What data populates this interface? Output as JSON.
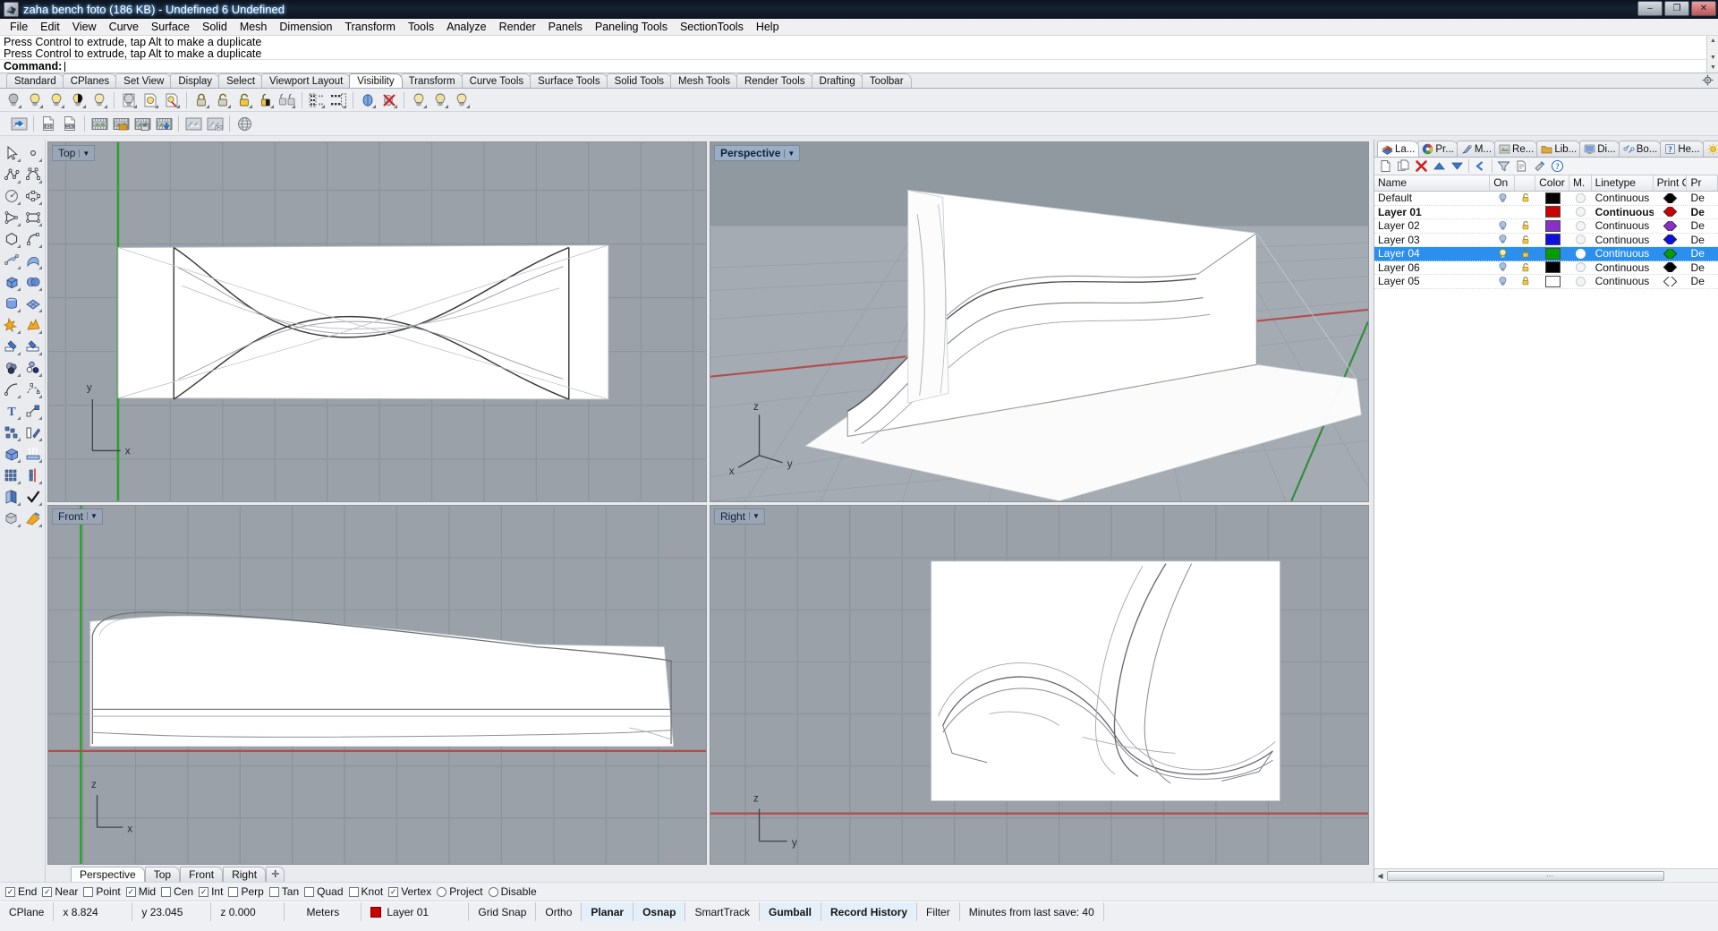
{
  "window": {
    "title": "zaha bench foto (186 KB) - Undefined 6 Undefined",
    "app_icon": "rhino-logo-icon",
    "minimize": "–",
    "maximize": "❐",
    "close": "✕"
  },
  "menu": {
    "items": [
      "File",
      "Edit",
      "View",
      "Curve",
      "Surface",
      "Solid",
      "Mesh",
      "Dimension",
      "Transform",
      "Tools",
      "Analyze",
      "Render",
      "Panels",
      "Paneling Tools",
      "SectionTools",
      "Help"
    ]
  },
  "command": {
    "history": [
      "Press Control to extrude, tap Alt to make a duplicate",
      "Press Control to extrude, tap Alt to make a duplicate"
    ],
    "prompt_label": "Command:",
    "prompt_value": ""
  },
  "toolbar_tabs": {
    "active": "Visibility",
    "items": [
      "Standard",
      "CPlanes",
      "Set View",
      "Display",
      "Select",
      "Viewport Layout",
      "Visibility",
      "Transform",
      "Curve Tools",
      "Surface Tools",
      "Solid Tools",
      "Mesh Tools",
      "Render Tools",
      "Drafting",
      "Toolbar"
    ]
  },
  "visibility_toolbar": {
    "buttons": [
      {
        "name": "hide-objects-icon",
        "title": "Hide objects"
      },
      {
        "name": "show-objects-icon",
        "title": "Show objects"
      },
      {
        "name": "show-selected-icon",
        "title": "Show selected"
      },
      {
        "name": "invert-hidden-icon",
        "title": "Invert hidden"
      },
      {
        "name": "hide-swap-icon",
        "title": "Hide swap"
      },
      {
        "name": "isolate-objects-icon",
        "title": "Isolate objects"
      },
      {
        "name": "unisolate-objects-icon",
        "title": "Un-isolate"
      },
      {
        "name": "isolate-layer-icon",
        "title": "Isolate layer"
      },
      {
        "name": "lock-objects-icon",
        "title": "Lock objects"
      },
      {
        "name": "unlock-objects-icon",
        "title": "Unlock objects"
      },
      {
        "name": "unlock-selected-icon",
        "title": "Unlock selected"
      },
      {
        "name": "invert-locked-icon",
        "title": "Invert locked"
      },
      {
        "name": "lock-swap-icon",
        "title": "Lock swap"
      },
      {
        "name": "select-visible-icon",
        "title": "Select visible"
      },
      {
        "name": "select-hidden-icon",
        "title": "Select hidden"
      },
      {
        "name": "show-in-viewport-icon",
        "title": "Show in viewport"
      },
      {
        "name": "hide-in-viewport-icon",
        "title": "Hide in viewport"
      },
      {
        "name": "show-bulb-1-icon",
        "title": "Show layer 1"
      },
      {
        "name": "show-bulb-2-icon",
        "title": "Show layer 2"
      },
      {
        "name": "show-bulb-3-icon",
        "title": "Show layer 3"
      }
    ]
  },
  "render_toolbar": {
    "buttons": [
      {
        "name": "render-preview-icon",
        "title": "Render preview"
      },
      {
        "name": "export-exe-icon",
        "title": "Export EXE"
      },
      {
        "name": "export-web-icon",
        "title": "Export WEB"
      },
      {
        "name": "animation-icon",
        "title": "Animation"
      },
      {
        "name": "animation-folder-icon",
        "title": "Animation folder"
      },
      {
        "name": "animation-save-icon",
        "title": "Save animation"
      },
      {
        "name": "animation-download-icon",
        "title": "Record animation"
      },
      {
        "name": "render-window-icon",
        "title": "Render window"
      },
      {
        "name": "render-window-jpg-icon",
        "title": "Render to file"
      },
      {
        "name": "globe-render-icon",
        "title": "Environment"
      }
    ]
  },
  "sidebar_tools": {
    "buttons": [
      {
        "name": "select-arrow-icon"
      },
      {
        "name": "point-object-icon"
      },
      {
        "name": "polyline-icon"
      },
      {
        "name": "control-point-curve-icon"
      },
      {
        "name": "circle-icon"
      },
      {
        "name": "ellipse-icon"
      },
      {
        "name": "polygon-triangle-icon"
      },
      {
        "name": "rectangle-icon"
      },
      {
        "name": "polygon-icon"
      },
      {
        "name": "arc-icon"
      },
      {
        "name": "surface-control-points-icon"
      },
      {
        "name": "surface-sweep-icon"
      },
      {
        "name": "box-solid-icon"
      },
      {
        "name": "sphere-solid-icon"
      },
      {
        "name": "cylinder-solid-icon"
      },
      {
        "name": "mesh-plane-icon"
      },
      {
        "name": "boolean-union-icon"
      },
      {
        "name": "boolean-split-icon"
      },
      {
        "name": "trim-icon"
      },
      {
        "name": "split-icon"
      },
      {
        "name": "boolean-objects-icon"
      },
      {
        "name": "point-groups-icon"
      },
      {
        "name": "fillet-curve-icon"
      },
      {
        "name": "offset-curve-icon"
      },
      {
        "name": "text-icon"
      },
      {
        "name": "scale-icon"
      },
      {
        "name": "explode-icon"
      },
      {
        "name": "extrude-icon"
      },
      {
        "name": "box-edit-icon"
      },
      {
        "name": "extrude-surface-icon"
      },
      {
        "name": "array-icon"
      },
      {
        "name": "array-polar-icon"
      },
      {
        "name": "copy-icon"
      },
      {
        "name": "check-objects-icon"
      },
      {
        "name": "cap-planar-holes-icon"
      },
      {
        "name": "render-shade-icon"
      }
    ]
  },
  "viewports": [
    {
      "name": "Top",
      "label": "Top",
      "active": false
    },
    {
      "name": "Perspective",
      "label": "Perspective",
      "active": true
    },
    {
      "name": "Front",
      "label": "Front",
      "active": false
    },
    {
      "name": "Right",
      "label": "Right",
      "active": false
    }
  ],
  "viewport_tabs": {
    "active": "Perspective",
    "items": [
      "Perspective",
      "Top",
      "Front",
      "Right"
    ],
    "add_label": "✛"
  },
  "panel_tabs": {
    "active": "La...",
    "items": [
      {
        "label": "La...",
        "icon": "layers-icon",
        "full": "Layers"
      },
      {
        "label": "Pr...",
        "icon": "properties-icon",
        "full": "Properties"
      },
      {
        "label": "M...",
        "icon": "materials-icon",
        "full": "Materials"
      },
      {
        "label": "Re...",
        "icon": "render-icon",
        "full": "Render"
      },
      {
        "label": "Lib...",
        "icon": "libraries-icon",
        "full": "Libraries"
      },
      {
        "label": "Di...",
        "icon": "display-icon",
        "full": "Display"
      },
      {
        "label": "Bo...",
        "icon": "bongo-icon",
        "full": "Bongo"
      },
      {
        "label": "He...",
        "icon": "help-icon",
        "full": "Help"
      },
      {
        "label": "Sun",
        "icon": "sun-icon",
        "full": "Sun"
      }
    ],
    "close_label": "✕"
  },
  "layer_toolbar": {
    "buttons": [
      {
        "name": "new-layer-icon",
        "title": "New layer"
      },
      {
        "name": "new-sublayer-icon",
        "title": "New sublayer"
      },
      {
        "name": "delete-layer-icon",
        "title": "Delete layer"
      },
      {
        "name": "move-layer-up-icon",
        "title": "Move up"
      },
      {
        "name": "move-layer-down-icon",
        "title": "Move down"
      },
      {
        "name": "previous-layer-icon",
        "title": "Previous"
      },
      {
        "name": "filter-layer-icon",
        "title": "Filter"
      },
      {
        "name": "layer-properties-icon",
        "title": "Properties"
      },
      {
        "name": "layer-tools-icon",
        "title": "Layer tools"
      },
      {
        "name": "layer-help-icon",
        "title": "Help"
      }
    ]
  },
  "layers": {
    "columns": [
      "Name",
      "On",
      "",
      "Color",
      "M.",
      "Linetype",
      "Print Co...",
      "Pr"
    ],
    "rows": [
      {
        "name": "Default",
        "on": true,
        "locked": false,
        "color": "#000000",
        "material": false,
        "linetype": "Continuous",
        "print_color": "#000000",
        "print_width": "De",
        "bold": false,
        "selected": false
      },
      {
        "name": "Layer 01",
        "on": false,
        "locked": false,
        "hide_bulb": true,
        "color": "#cc0000",
        "material": false,
        "linetype": "Continuous",
        "print_color": "#cc0000",
        "print_width": "De",
        "bold": true,
        "selected": false
      },
      {
        "name": "Layer 02",
        "on": true,
        "locked": false,
        "color": "#8b2fc9",
        "material": false,
        "linetype": "Continuous",
        "print_color": "#8b2fc9",
        "print_width": "De",
        "bold": false,
        "selected": false
      },
      {
        "name": "Layer 03",
        "on": true,
        "locked": false,
        "color": "#0f0fe0",
        "material": false,
        "linetype": "Continuous",
        "print_color": "#0f0fe0",
        "print_width": "De",
        "bold": false,
        "selected": false
      },
      {
        "name": "Layer 04",
        "on": true,
        "locked": false,
        "color": "#00a000",
        "material": true,
        "linetype": "Continuous",
        "print_color": "#00a000",
        "print_width": "De",
        "bold": false,
        "selected": true
      },
      {
        "name": "Layer 06",
        "on": true,
        "locked": false,
        "color": "#000000",
        "material": false,
        "linetype": "Continuous",
        "print_color": "#000000",
        "print_width": "De",
        "bold": false,
        "selected": false
      },
      {
        "name": "Layer 05",
        "on": true,
        "locked": true,
        "color": "#ffffff",
        "material": false,
        "linetype": "Continuous",
        "print_color": "#ffffff",
        "print_width": "De",
        "bold": false,
        "selected": false
      }
    ]
  },
  "osnap": {
    "items": [
      {
        "label": "End",
        "checked": true,
        "round": false
      },
      {
        "label": "Near",
        "checked": true,
        "round": false
      },
      {
        "label": "Point",
        "checked": false,
        "round": false
      },
      {
        "label": "Mid",
        "checked": true,
        "round": false
      },
      {
        "label": "Cen",
        "checked": false,
        "round": false
      },
      {
        "label": "Int",
        "checked": true,
        "round": false
      },
      {
        "label": "Perp",
        "checked": false,
        "round": false
      },
      {
        "label": "Tan",
        "checked": false,
        "round": false
      },
      {
        "label": "Quad",
        "checked": false,
        "round": false
      },
      {
        "label": "Knot",
        "checked": false,
        "round": false
      },
      {
        "label": "Vertex",
        "checked": true,
        "round": false
      },
      {
        "label": "Project",
        "checked": false,
        "round": true
      },
      {
        "label": "Disable",
        "checked": false,
        "round": true
      }
    ]
  },
  "status": {
    "cplane": "CPlane",
    "x": "x 8.824",
    "y": "y 23.045",
    "z": "z 0.000",
    "units": "Meters",
    "layer": "Layer 01",
    "layer_color": "#cc0000",
    "toggles": [
      {
        "label": "Grid Snap",
        "on": false
      },
      {
        "label": "Ortho",
        "on": false
      },
      {
        "label": "Planar",
        "on": true
      },
      {
        "label": "Osnap",
        "on": true
      },
      {
        "label": "SmartTrack",
        "on": false
      },
      {
        "label": "Gumball",
        "on": true
      },
      {
        "label": "Record History",
        "on": true
      },
      {
        "label": "Filter",
        "on": false
      }
    ],
    "save_info": "Minutes from last save: 40"
  }
}
